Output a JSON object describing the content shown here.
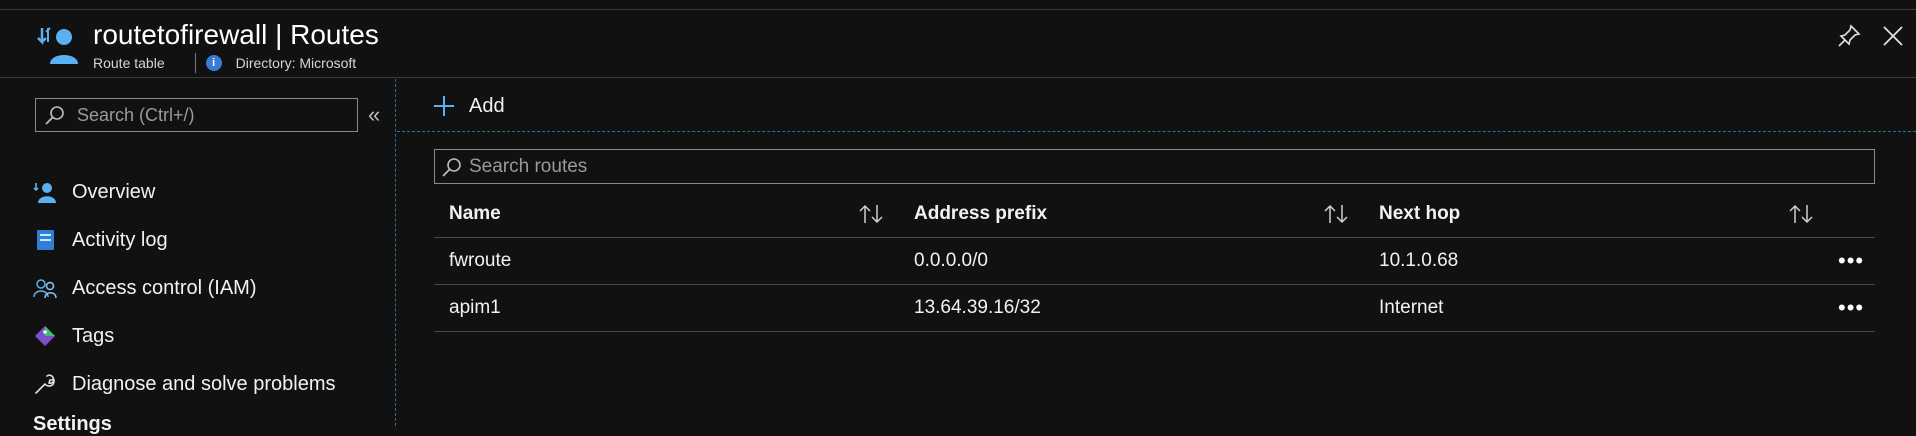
{
  "header": {
    "title": "routetofirewall | Routes",
    "resource_type": "Route table",
    "info_glyph": "i",
    "directory": "Directory: Microsoft"
  },
  "sidebar": {
    "search_placeholder": "Search (Ctrl+/)",
    "collapse_glyph": "«",
    "items": [
      {
        "label": "Overview",
        "icon": "overview-icon"
      },
      {
        "label": "Activity log",
        "icon": "activity-log-icon"
      },
      {
        "label": "Access control (IAM)",
        "icon": "iam-icon"
      },
      {
        "label": "Tags",
        "icon": "tag-icon"
      },
      {
        "label": "Diagnose and solve problems",
        "icon": "wrench-icon"
      }
    ],
    "section_settings": "Settings"
  },
  "toolbar": {
    "add_label": "Add"
  },
  "routes": {
    "search_placeholder": "Search routes",
    "columns": [
      "Name",
      "Address prefix",
      "Next hop"
    ],
    "rows": [
      {
        "name": "fwroute",
        "prefix": "0.0.0.0/0",
        "next_hop": "10.1.0.68",
        "more": "•••"
      },
      {
        "name": "apim1",
        "prefix": "13.64.39.16/32",
        "next_hop": "Internet",
        "more": "•••"
      }
    ]
  },
  "colors": {
    "background": "#111111",
    "accent": "#3a96dd",
    "text": "#f2f2f2",
    "border": "#4a4a4a"
  }
}
